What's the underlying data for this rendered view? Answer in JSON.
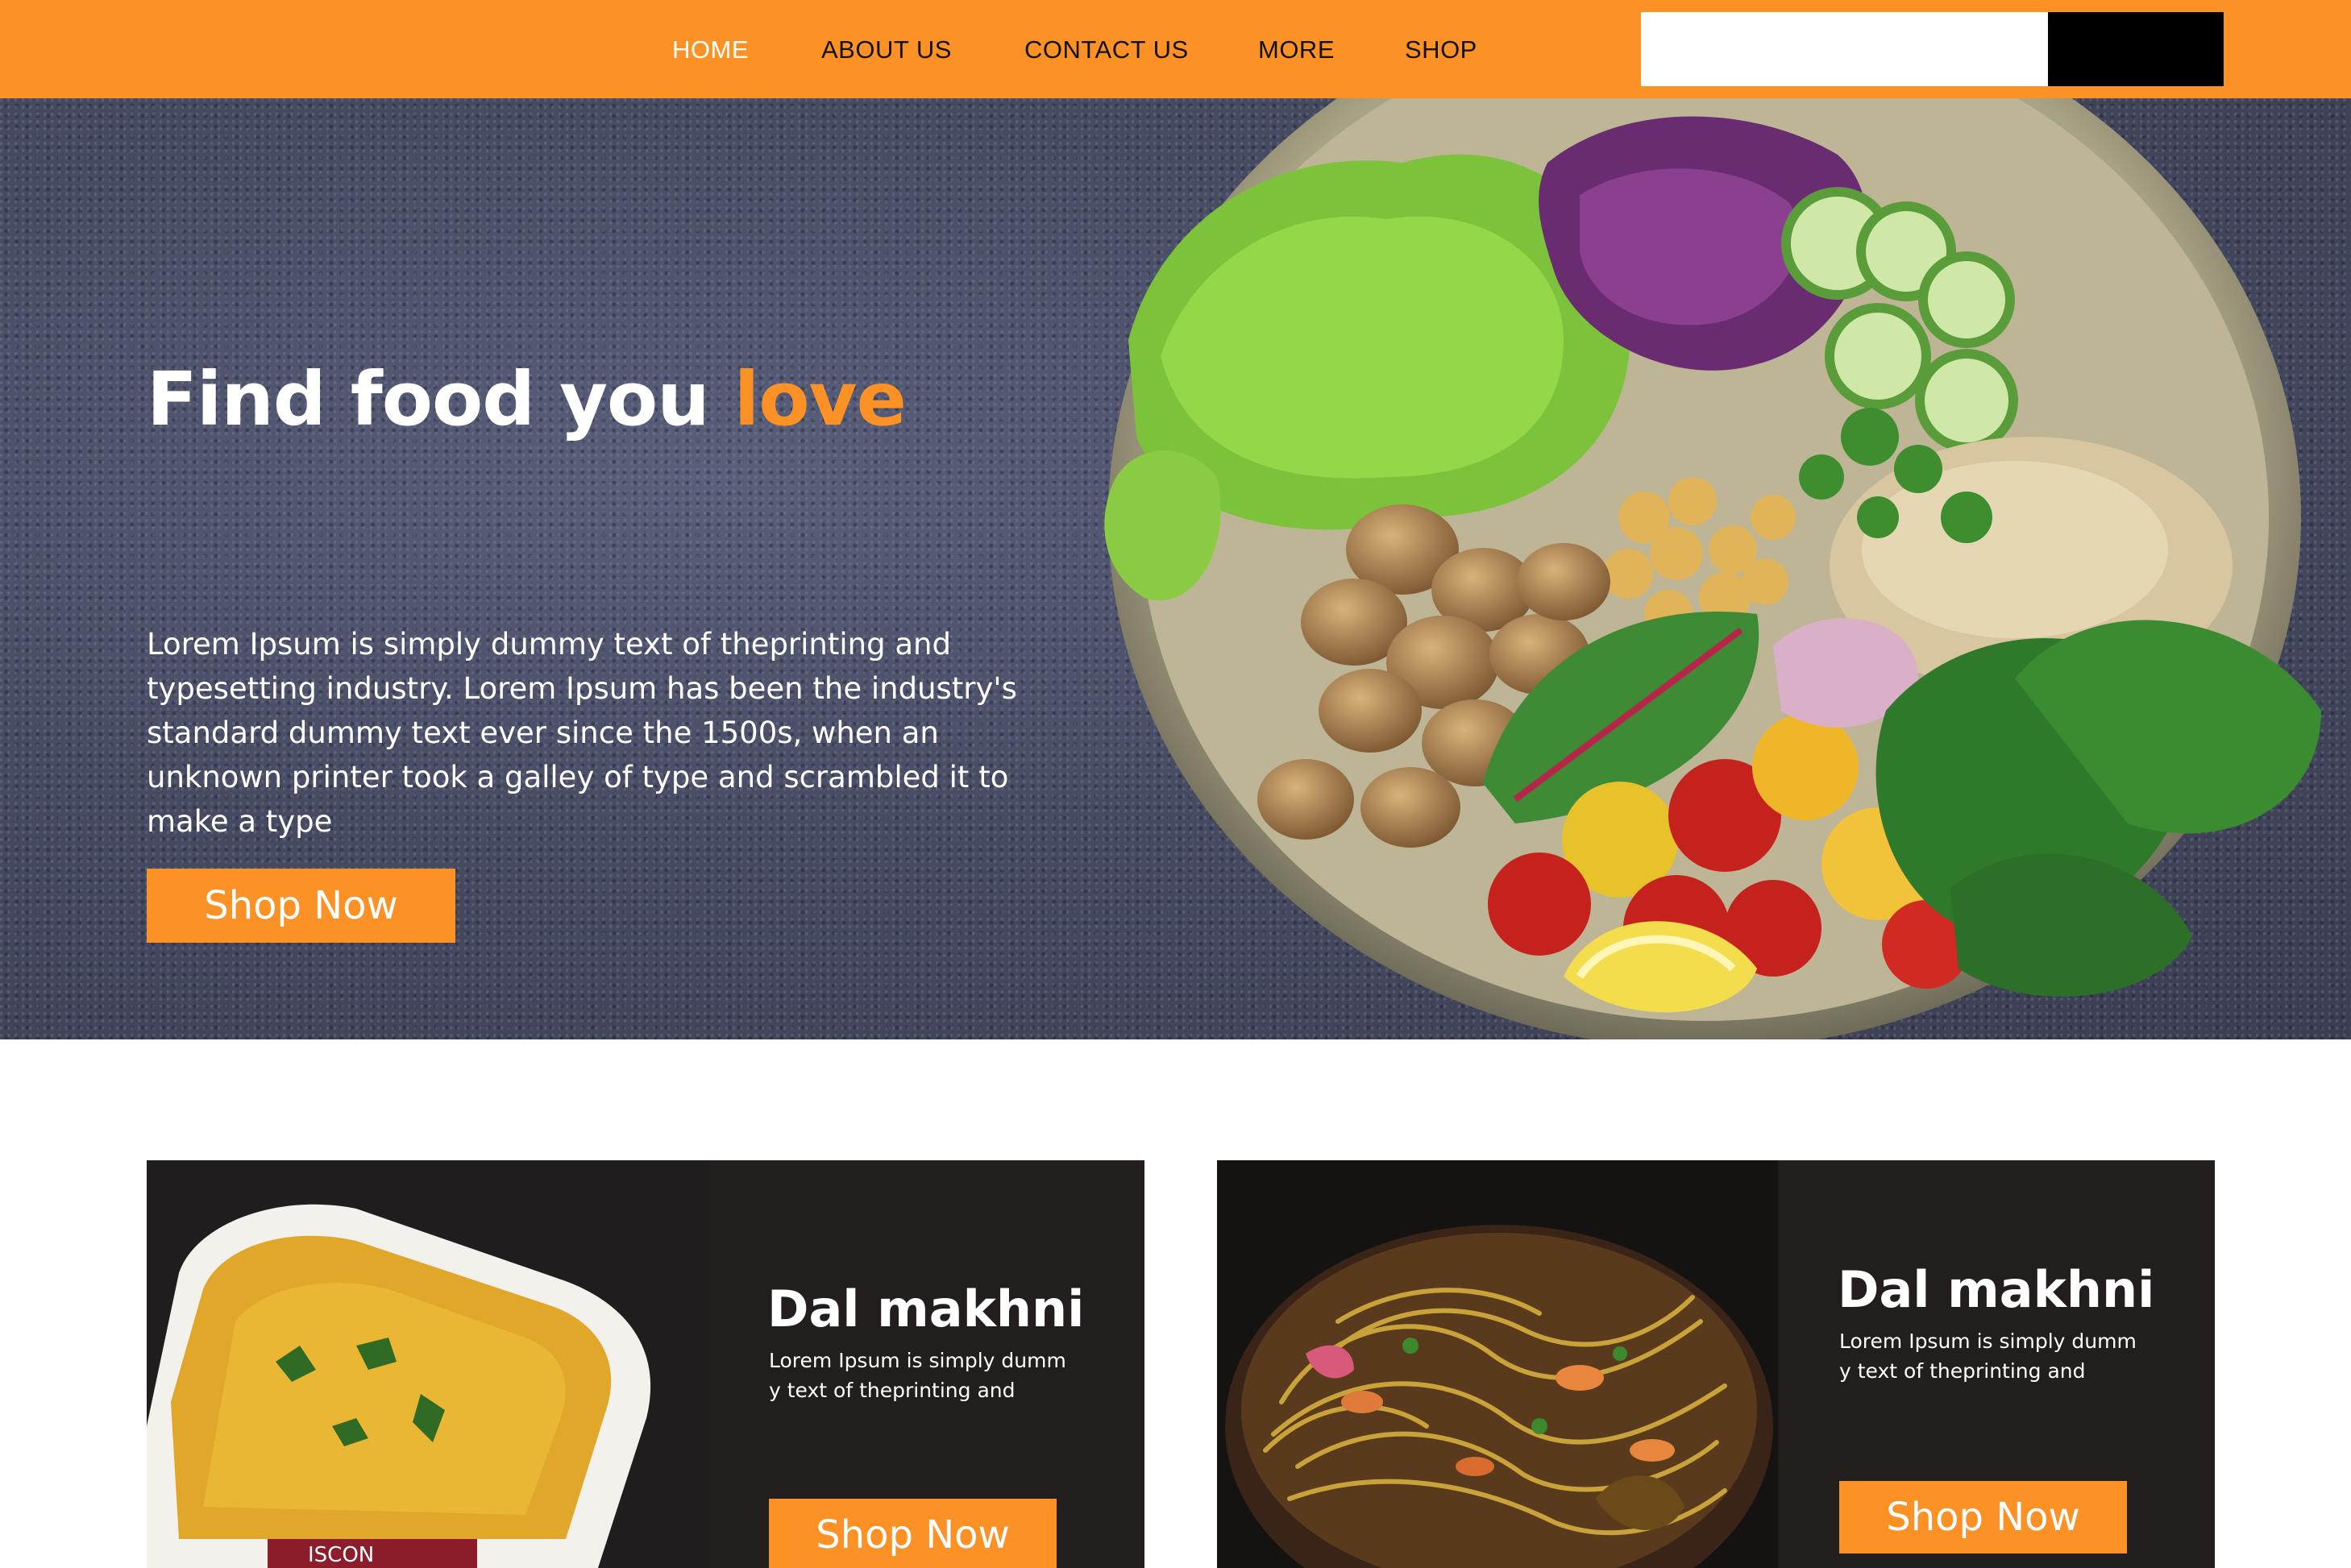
{
  "nav": {
    "items": [
      {
        "label": "HOME",
        "active": true
      },
      {
        "label": "ABOUT US",
        "active": false
      },
      {
        "label": "CONTACT US",
        "active": false
      },
      {
        "label": "MORE",
        "active": false
      },
      {
        "label": "SHOP",
        "active": false
      }
    ],
    "search": {
      "value": "",
      "placeholder": "",
      "button_label": ""
    }
  },
  "hero": {
    "title_prefix": "Find food you ",
    "title_accent": "love",
    "body": "Lorem Ipsum is simply dummy text of theprinting and typesetting industry. Lorem Ipsum has been the industry's standard dummy text ever since the 1500s, when an unknown printer took a galley of type and scrambled it to make a type",
    "button_label": "Shop Now",
    "image_icon": "salad-bowl-image"
  },
  "cards": [
    {
      "title": "Dal makhni",
      "description": "Lorem Ipsum is simply dummy text of theprinting and",
      "button_label": "Shop Now",
      "image_icon": "dal-makhni-tray-image",
      "image_brand_text": "ISCON"
    },
    {
      "title": "Dal makhni",
      "description": "Lorem Ipsum is simply dummy text of theprinting and",
      "button_label": "Shop Now",
      "image_icon": "noodle-bowl-image"
    }
  ],
  "colors": {
    "accent": "#fc9126",
    "nav_text": "#111111",
    "nav_active_text": "#ffffff",
    "hero_background": "#474b62",
    "card_background": "#231e1e",
    "search_button": "#000000"
  }
}
